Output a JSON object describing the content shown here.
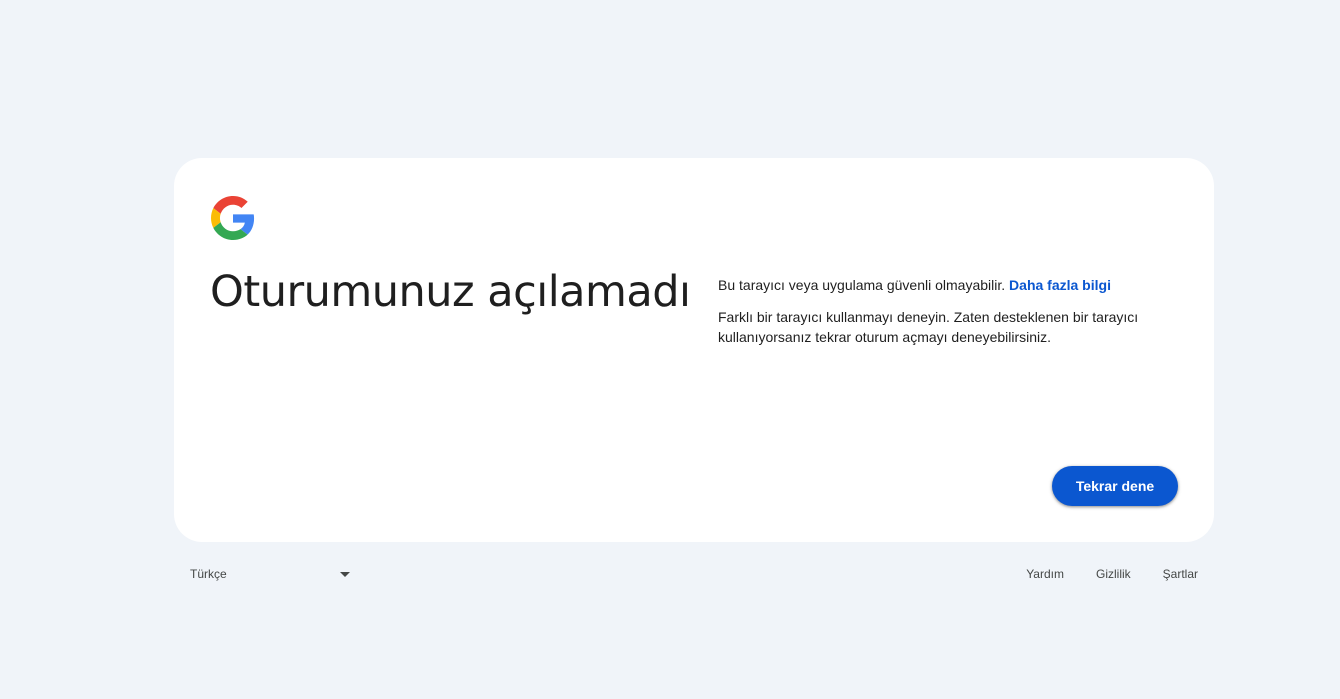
{
  "card": {
    "title": "Oturumunuz açılamadı",
    "message_1": "Bu tarayıcı veya uygulama güvenli olmayabilir.",
    "learn_more_link": "Daha fazla bilgi",
    "message_2": "Farklı bir tarayıcı kullanmayı deneyin. Zaten desteklenen bir tarayıcı kullanıyorsanız tekrar oturum açmayı deneyebilirsiniz.",
    "retry_button": "Tekrar dene"
  },
  "footer": {
    "language": "Türkçe",
    "links": [
      "Yardım",
      "Gizlilik",
      "Şartlar"
    ]
  },
  "colors": {
    "page_background": "#f0f4f9",
    "card_background": "#ffffff",
    "primary": "#0b57d0",
    "text": "#1f1f1f",
    "footer_text": "#444746"
  },
  "icons": {
    "logo": "google-g-logo-icon",
    "language_dropdown": "caret-down-icon"
  }
}
